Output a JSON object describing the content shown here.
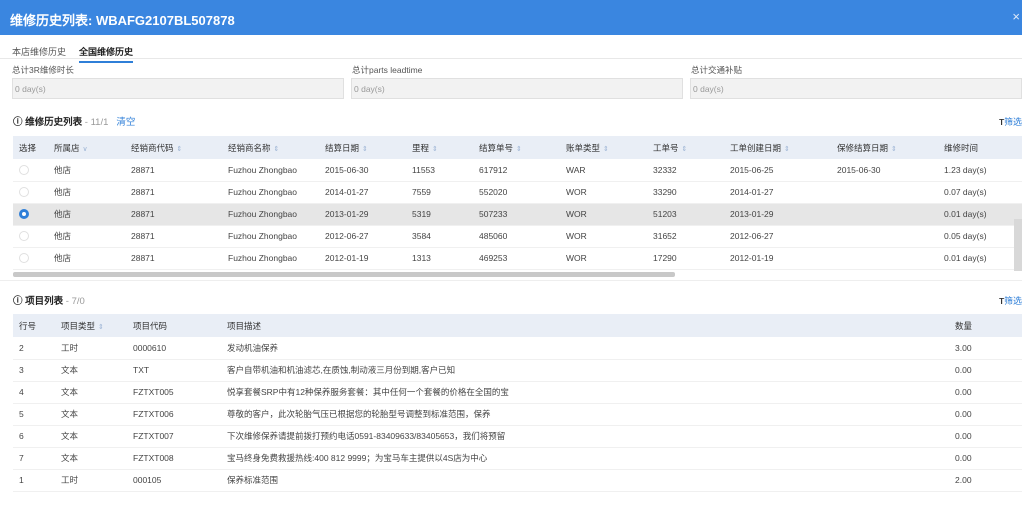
{
  "window": {
    "title": "维修历史列表: WBAFG2107BL507878",
    "close_glyph": "×"
  },
  "tabs": [
    {
      "label": "本店维修历史"
    },
    {
      "label": "全国维修历史",
      "active": true
    }
  ],
  "summary": [
    {
      "label": "总计3R维修时长",
      "value": "0 day(s)"
    },
    {
      "label": "总计parts leadtime",
      "value": "0 day(s)"
    },
    {
      "label": "总计交通补贴",
      "value": "0 day(s)"
    }
  ],
  "history": {
    "title": "维修历史列表",
    "count": " - 11/1",
    "clear_label": "清空",
    "filter_label": "筛选",
    "columns": [
      "选择",
      "所属店",
      "经销商代码",
      "经销商名称",
      "结算日期",
      "里程",
      "结算单号",
      "账单类型",
      "工单号",
      "工单创建日期",
      "保修结算日期",
      "维修时间"
    ],
    "rows": [
      {
        "selected": false,
        "cells": [
          "他店",
          "28871",
          "Fuzhou Zhongbao",
          "2015-06-30",
          "11553",
          "617912",
          "WAR",
          "32332",
          "2015-06-25",
          "2015-06-30",
          "1.23 day(s)"
        ]
      },
      {
        "selected": false,
        "cells": [
          "他店",
          "28871",
          "Fuzhou Zhongbao",
          "2014-01-27",
          "7559",
          "552020",
          "WOR",
          "33290",
          "2014-01-27",
          "",
          "0.07 day(s)"
        ]
      },
      {
        "selected": true,
        "cells": [
          "他店",
          "28871",
          "Fuzhou Zhongbao",
          "2013-01-29",
          "5319",
          "507233",
          "WOR",
          "51203",
          "2013-01-29",
          "",
          "0.01 day(s)"
        ]
      },
      {
        "selected": false,
        "cells": [
          "他店",
          "28871",
          "Fuzhou Zhongbao",
          "2012-06-27",
          "3584",
          "485060",
          "WOR",
          "31652",
          "2012-06-27",
          "",
          "0.05 day(s)"
        ]
      },
      {
        "selected": false,
        "cells": [
          "他店",
          "28871",
          "Fuzhou Zhongbao",
          "2012-01-19",
          "1313",
          "469253",
          "WOR",
          "17290",
          "2012-01-19",
          "",
          "0.01 day(s)"
        ]
      }
    ]
  },
  "items": {
    "title": "项目列表",
    "count": " - 7/0",
    "filter_label": "筛选",
    "columns": [
      "行号",
      "项目类型",
      "项目代码",
      "项目描述",
      "数量"
    ],
    "rows": [
      [
        "2",
        "工时",
        "0000610",
        "发动机油保养",
        "3.00"
      ],
      [
        "3",
        "文本",
        "TXT",
        "客户自带机油和机油滤芯,在质蚀,制动液三月份到期,客户已知",
        "0.00"
      ],
      [
        "4",
        "文本",
        "FZTXT005",
        "悦享套餐SRP中有12种保养服务套餐：其中任何一个套餐的价格在全国的宝",
        "0.00"
      ],
      [
        "5",
        "文本",
        "FZTXT006",
        "尊敬的客户，此次轮胎气压已根据您的轮胎型号调整到标准范围，保养",
        "0.00"
      ],
      [
        "6",
        "文本",
        "FZTXT007",
        "下次维修保养请提前拨打预约电话0591-83409633/83405653，我们将预留",
        "0.00"
      ],
      [
        "7",
        "文本",
        "FZTXT008",
        "宝马终身免费救援热线:400 812 9999；为宝马车主提供以4S店为中心",
        "0.00"
      ],
      [
        "1",
        "工时",
        "000105",
        "保养标准范围",
        "2.00"
      ]
    ]
  }
}
